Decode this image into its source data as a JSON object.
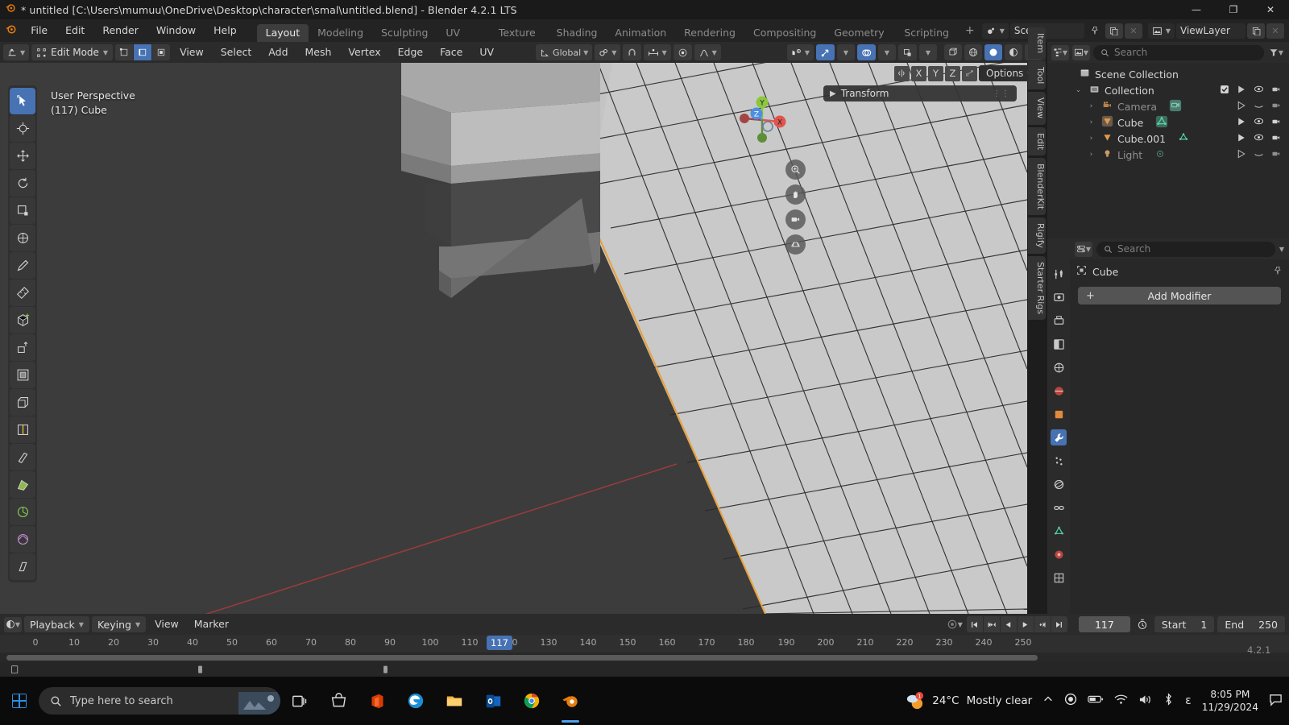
{
  "titlebar": {
    "app_icon": "blender-logo",
    "title": "* untitled [C:\\Users\\mumuu\\OneDrive\\Desktop\\character\\smal\\untitled.blend] - Blender 4.2.1 LTS",
    "minimize": "—",
    "maximize": "❐",
    "close": "✕"
  },
  "topbar": {
    "menus": [
      "File",
      "Edit",
      "Render",
      "Window",
      "Help"
    ],
    "workspaces": [
      {
        "label": "Layout",
        "active": true
      },
      {
        "label": "Modeling",
        "active": false
      },
      {
        "label": "Sculpting",
        "active": false
      },
      {
        "label": "UV Editing",
        "active": false
      },
      {
        "label": "Texture Paint",
        "active": false
      },
      {
        "label": "Shading",
        "active": false
      },
      {
        "label": "Animation",
        "active": false
      },
      {
        "label": "Rendering",
        "active": false
      },
      {
        "label": "Compositing",
        "active": false
      },
      {
        "label": "Geometry Nodes",
        "active": false
      },
      {
        "label": "Scripting",
        "active": false
      }
    ],
    "add_workspace": "+",
    "scene_name": "Scene",
    "viewlayer_name": "ViewLayer",
    "pin_icon": "pin-icon",
    "copy_icon": "duplicate-icon",
    "close_icon": "✕"
  },
  "viewport_header": {
    "editor_type_icon": "editor-type-icon",
    "mode": "Edit Mode",
    "select_modes": [
      {
        "name": "vertex-select",
        "active": false
      },
      {
        "name": "edge-select",
        "active": true
      },
      {
        "name": "face-select",
        "active": false
      }
    ],
    "menus": [
      "View",
      "Select",
      "Add",
      "Mesh",
      "Vertex",
      "Edge",
      "Face",
      "UV"
    ],
    "transform_orientation": "Global",
    "pivot_icon": "pivot-point-icon",
    "snap_icon": "magnet-icon",
    "snap_target_icon": "snap-increment-icon",
    "proportional_icon": "proportional-editing-icon",
    "falloff_icon": "smooth-falloff-icon",
    "visibility_icon": "show-whole-scene-icon",
    "gizmo_icon": "gizmo-icon",
    "overlays_icon": "overlays-icon",
    "xray_icon": "xray-icon",
    "shading_modes": [
      {
        "name": "wireframe-shading",
        "active": false
      },
      {
        "name": "solid-shading",
        "active": true
      },
      {
        "name": "material-preview-shading",
        "active": false
      },
      {
        "name": "rendered-shading",
        "active": false
      }
    ]
  },
  "viewport_row2": {
    "mirror_icon": "mirror-icon",
    "axes": [
      "X",
      "Y",
      "Z"
    ],
    "snap_proj_icon": "auto-merge-icon",
    "options_label": "Options"
  },
  "viewport": {
    "perspective_label": "User Perspective",
    "object_label": "(117) Cube",
    "gizmo_axes": [
      {
        "label": "X",
        "color": "#e0544f"
      },
      {
        "label": "Y",
        "color": "#8dc63f"
      },
      {
        "label": "Z",
        "color": "#4f8fe0"
      }
    ],
    "nav_buttons": [
      "zoom-icon",
      "pan-hand-icon",
      "camera-view-icon",
      "toggle-orthographic-icon"
    ],
    "transform_panel_title": "Transform",
    "sidebar_tabs": [
      "Item",
      "Tool",
      "View",
      "Edit",
      "BlenderKit",
      "Rigify",
      "Starter Rigs"
    ],
    "tools": [
      {
        "name": "tweak-select-tool",
        "active": true
      },
      {
        "name": "cursor-tool",
        "active": false
      },
      {
        "name": "move-tool",
        "active": false
      },
      {
        "name": "rotate-tool",
        "active": false
      },
      {
        "name": "scale-tool",
        "active": false
      },
      {
        "name": "transform-tool",
        "active": false
      },
      {
        "name": "annotate-tool",
        "active": false
      },
      {
        "name": "measure-tool",
        "active": false
      },
      {
        "name": "add-cube-tool",
        "active": false
      },
      {
        "name": "extrude-region-tool",
        "active": false
      },
      {
        "name": "inset-faces-tool",
        "active": false
      },
      {
        "name": "bevel-tool",
        "active": false
      },
      {
        "name": "loop-cut-tool",
        "active": false
      },
      {
        "name": "knife-tool",
        "active": false
      },
      {
        "name": "poly-build-tool",
        "active": false
      },
      {
        "name": "spin-tool",
        "active": false
      },
      {
        "name": "smooth-tool",
        "active": false
      },
      {
        "name": "shear-tool",
        "active": false
      }
    ],
    "grid_color": "#c9c9c9",
    "bg_color": "#3c3c3c",
    "x_axis_color": "#b34040",
    "selected_edge_color": "#e8a13c"
  },
  "outliner": {
    "display_mode_icon": "outliner-display-mode-icon",
    "filter_icon": "filter-icon",
    "search_placeholder": "Search",
    "rows": [
      {
        "name": "Scene Collection",
        "icon": "scene-collection-icon",
        "depth": 0,
        "disclose": "",
        "dim": false,
        "has_checkbox": false,
        "selectable_icon": null
      },
      {
        "name": "Collection",
        "icon": "collection-icon",
        "depth": 1,
        "disclose": "⌄",
        "dim": false,
        "has_checkbox": true,
        "selectable_icon": null
      },
      {
        "name": "Camera",
        "icon": "camera-icon",
        "depth": 2,
        "disclose": "›",
        "dim": true,
        "has_checkbox": false,
        "selectable_icon": "camera-data-icon"
      },
      {
        "name": "Cube",
        "icon": "mesh-object-icon",
        "depth": 2,
        "disclose": "›",
        "dim": false,
        "has_checkbox": false,
        "selectable_icon": "mesh-data-icon"
      },
      {
        "name": "Cube.001",
        "icon": "mesh-object-icon",
        "depth": 2,
        "disclose": "›",
        "dim": false,
        "has_checkbox": false,
        "selectable_icon": "mesh-data-icon"
      },
      {
        "name": "Light",
        "icon": "light-icon",
        "depth": 2,
        "disclose": "›",
        "dim": true,
        "has_checkbox": false,
        "selectable_icon": "light-data-icon"
      }
    ]
  },
  "properties": {
    "editor_icon": "properties-editor-icon",
    "search_placeholder": "Search",
    "breadcrumb_object": "Cube",
    "pin_icon": "pin-icon",
    "add_modifier_label": "Add Modifier",
    "add_modifier_plus": "+",
    "tabs": [
      {
        "name": "tool-tab",
        "glyph": "⚒",
        "active": false
      },
      {
        "name": "render-tab",
        "glyph": "▣",
        "active": false
      },
      {
        "name": "output-tab",
        "glyph": "⎙",
        "active": false
      },
      {
        "name": "view-layer-tab",
        "glyph": "◧",
        "active": false
      },
      {
        "name": "scene-tab",
        "glyph": "◎",
        "active": false
      },
      {
        "name": "world-tab",
        "glyph": "●",
        "active": false
      },
      {
        "name": "object-tab",
        "glyph": "■",
        "active": false
      },
      {
        "name": "modifiers-tab",
        "glyph": "🔧",
        "active": true
      },
      {
        "name": "particles-tab",
        "glyph": "⁂",
        "active": false
      },
      {
        "name": "physics-tab",
        "glyph": "◔",
        "active": false
      },
      {
        "name": "constraints-tab",
        "glyph": "⛓",
        "active": false
      },
      {
        "name": "object-data-tab",
        "glyph": "▽",
        "active": false
      },
      {
        "name": "material-tab",
        "glyph": "●",
        "active": false
      },
      {
        "name": "texture-tab",
        "glyph": "▦",
        "active": false
      }
    ]
  },
  "timeline": {
    "editor_icon": "timeline-editor-icon",
    "menus_boxed": [
      "Playback",
      "Keying"
    ],
    "menus_plain": [
      "View",
      "Marker"
    ],
    "auto_key_icon": "record-icon",
    "transport": [
      {
        "name": "jump-to-start-button",
        "glyph": "⏮"
      },
      {
        "name": "jump-to-prev-keyframe-button",
        "glyph": "⏪"
      },
      {
        "name": "play-reverse-button",
        "glyph": "◀"
      },
      {
        "name": "play-button",
        "glyph": "▶"
      },
      {
        "name": "jump-to-next-keyframe-button",
        "glyph": "⏩"
      },
      {
        "name": "jump-to-end-button",
        "glyph": "⏭"
      }
    ],
    "current_frame": "117",
    "start_label": "Start",
    "start_value": "1",
    "end_label": "End",
    "end_value": "250",
    "ruler_ticks": [
      0,
      10,
      20,
      30,
      40,
      50,
      60,
      70,
      80,
      90,
      100,
      110,
      120,
      130,
      140,
      150,
      160,
      170,
      180,
      190,
      200,
      210,
      220,
      230,
      240,
      250
    ],
    "playhead_frame": "117"
  },
  "status": {
    "version": "4.2.1"
  },
  "taskbar": {
    "start_icon": "windows-start-icon",
    "search_placeholder": "Type here to search",
    "apps": [
      {
        "name": "task-view-icon",
        "glyph": "◫",
        "active": false
      },
      {
        "name": "microsoft-store-icon",
        "glyph": "▦",
        "active": false
      },
      {
        "name": "microsoft-office-icon",
        "glyph": "◆",
        "active": false
      },
      {
        "name": "microsoft-edge-icon",
        "glyph": "◐",
        "active": false
      },
      {
        "name": "file-explorer-icon",
        "glyph": "▰",
        "active": false
      },
      {
        "name": "outlook-icon",
        "glyph": "◑",
        "active": false
      },
      {
        "name": "google-chrome-icon",
        "glyph": "●",
        "active": false
      },
      {
        "name": "blender-taskbar-icon",
        "glyph": "◕",
        "active": true
      }
    ],
    "weather_temp": "24°C",
    "weather_desc": "Mostly clear",
    "tray_icons": [
      "chevron-up-icon",
      "record-indicator-icon",
      "battery-icon",
      "wifi-icon",
      "volume-icon",
      "bluetooth-icon",
      "epsilon-icon"
    ],
    "time": "8:05 PM",
    "date": "11/29/2024",
    "notification_icon": "notification-icon"
  }
}
